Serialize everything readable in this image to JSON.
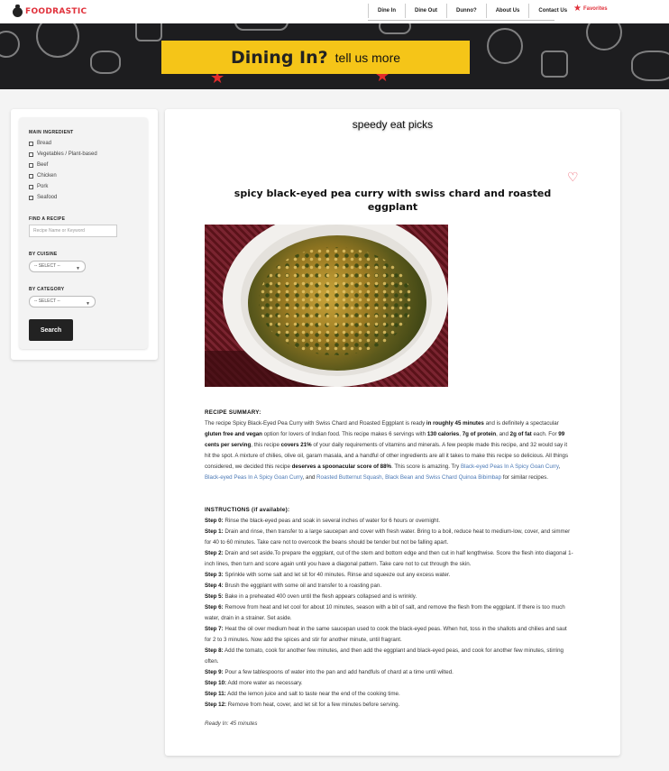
{
  "nav": {
    "logo_text": "FOODRASTIC",
    "menu": [
      "Dine In",
      "Dine Out",
      "Dunno?",
      "About Us",
      "Contact Us"
    ],
    "favorites_label": "Favorites"
  },
  "hero": {
    "title": "Dining In?",
    "subtitle": "tell us more"
  },
  "sidebar": {
    "main_ingredient_heading": "MAIN INGREDIENT",
    "ingredients": [
      "Bread",
      "Vegetables / Plant-based",
      "Beef",
      "Chicken",
      "Pork",
      "Seafood"
    ],
    "find_heading": "FIND A RECIPE",
    "search_placeholder": "Recipe Name or Keyword",
    "cuisine_heading": "BY CUISINE",
    "cuisine_value": "-- SELECT --",
    "category_heading": "BY CATEGORY",
    "category_value": "-- SELECT --",
    "search_button": "Search"
  },
  "main": {
    "heading": "speedy eat picks",
    "recipe_title": "spicy black-eyed pea curry with swiss chard and roasted eggplant",
    "summary_label": "RECIPE SUMMARY:",
    "summary": {
      "p1": "The recipe Spicy Black-Eyed Pea Curry with Swiss Chard and Roasted Eggplant is ready ",
      "b1": "in roughly 45 minutes",
      "p2": " and is definitely a spectacular ",
      "b2": "gluten free and vegan",
      "p3": " option for lovers of Indian food. This recipe makes 6 servings with ",
      "b3": "130 calories",
      "p4": ", ",
      "b4": "7g of protein",
      "p5": ", and ",
      "b5": "2g of fat",
      "p6": " each. For ",
      "b6": "99 cents per serving",
      "p7": ", this recipe ",
      "b7": "covers 21%",
      "p8": " of your daily requirements of vitamins and minerals. A few people made this recipe, and 32 would say it hit the spot. A mixture of chilies, olive oil, garam masala, and a handful of other ingredients are all it takes to make this recipe so delicious. All things considered, we decided this recipe ",
      "b8": "deserves a spoonacular score of 88%",
      "p9": ". This score is amazing. Try ",
      "l1": "Black-eyed Peas In A Spicy Goan Curry",
      "p10": ", ",
      "l2": "Black-eyed Peas In A Spicy Goan Curry",
      "p11": ", and ",
      "l3": "Roasted Butternut Squash, Black Bean and Swiss Chard Quinoa Bibimbap",
      "p12": " for similar recipes."
    },
    "instructions_label": "INSTRUCTIONS (if available):",
    "steps": [
      {
        "label": "Step 0:",
        "text": " Rinse the black-eyed peas and soak in several inches of water for 6 hours or overnight."
      },
      {
        "label": "Step 1:",
        "text": " Drain and rinse, then transfer to a large saucepan and cover with fresh water. Bring to a boil, reduce heat to medium-low, cover, and simmer for 40 to 60 minutes. Take care not to overcook the beans should be tender but not be falling apart."
      },
      {
        "label": "Step 2:",
        "text": " Drain and set aside.To prepare the eggplant, cut of the stem and bottom edge and then cut in half lengthwise. Score the flesh into diagonal 1-inch lines, then turn and score again until you have a diagonal pattern. Take care not to cut through the skin."
      },
      {
        "label": "Step 3:",
        "text": " Sprinkle with some salt and let sit for 40 minutes. Rinse and squeeze out any excess water."
      },
      {
        "label": "Step 4:",
        "text": " Brush the eggplant with some oil and transfer to a roasting pan."
      },
      {
        "label": "Step 5:",
        "text": " Bake in a preheated 400 oven until the flesh appears collapsed and is wrinkly."
      },
      {
        "label": "Step 6:",
        "text": " Remove from heat and let cool for about 10 minutes, season with a bit of salt, and remove the flesh from the eggplant. If there is too much water, drain in a strainer. Set aside."
      },
      {
        "label": "Step 7:",
        "text": " Heat the oil over medium heat in the same saucepan used to cook the black-eyed peas. When hot, toss in the shallots and chilies and saut for 2 to 3 minutes. Now add the spices and stir for another minute, until fragrant."
      },
      {
        "label": "Step 8:",
        "text": " Add the tomato, cook for another few minutes, and then add the eggplant and black-eyed peas, and cook for another few minutes, stirring often."
      },
      {
        "label": "Step 9:",
        "text": " Pour a few tablespoons of water into the pan and add handfuls of chard at a time until wilted."
      },
      {
        "label": "Step 10:",
        "text": " Add more water as necessary."
      },
      {
        "label": "Step 11:",
        "text": " Add the lemon juice and salt to taste near the end of the cooking time."
      },
      {
        "label": "Step 12:",
        "text": " Remove from heat, cover, and let sit for a few minutes before serving."
      }
    ],
    "ready_in": "Ready In: 45 minutes"
  },
  "colors": {
    "accent_red": "#e0303a",
    "banner_yellow": "#f5c518",
    "hero_dark": "#1d1d1f",
    "link_blue": "#4a78b5"
  }
}
